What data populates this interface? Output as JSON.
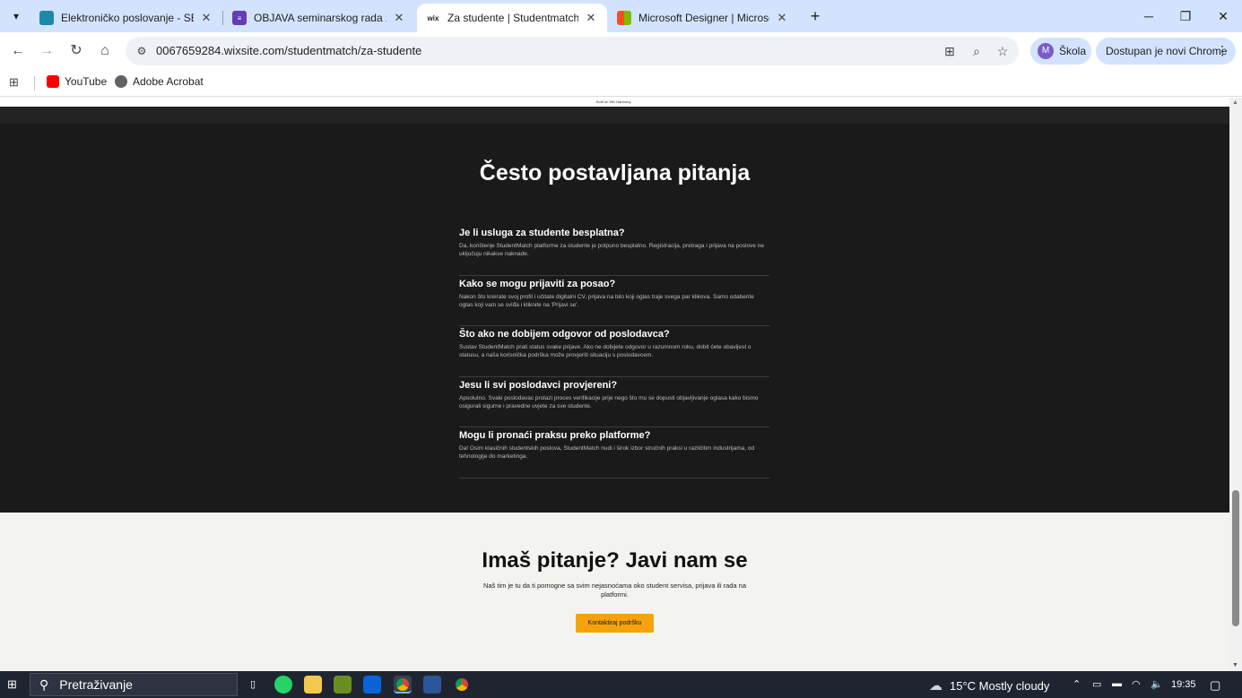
{
  "browser": {
    "tabs": [
      {
        "title": "Elektroničko poslovanje - SEMI",
        "favicon_color": "#1e88a8",
        "active": false
      },
      {
        "title": "OBJAVA seminarskog rada za ko",
        "favicon_color": "#673ab7",
        "active": false
      },
      {
        "title": "Za studente | Studentmatch",
        "favicon_label": "wix",
        "active": true
      },
      {
        "title": "Microsoft Designer | Microsoft",
        "favicon_color": "#f25022",
        "active": false
      }
    ],
    "url": "0067659284.wixsite.com/studentmatch/za-studente",
    "profile": {
      "initial": "M",
      "name": "Škola"
    },
    "update_label": "Dostupan je novi Chrome",
    "bookmarks": [
      {
        "label": "YouTube",
        "icon": "youtube-icon"
      },
      {
        "label": "Adobe Acrobat",
        "icon": "globe-icon"
      }
    ]
  },
  "page": {
    "wix_banner": "Built on Wix Harmony",
    "faq": {
      "heading": "Često postavljana pitanja",
      "items": [
        {
          "q": "Je li usluga za studente besplatna?",
          "a": "Da, korištenje StudentMatch platforme za studente je potpuno besplatno. Registracija, pretraga i prijava na poslove ne uključuju nikakve naknade."
        },
        {
          "q": "Kako se mogu prijaviti za posao?",
          "a": "Nakon što kreirate svoj profil i učitate digitalni CV, prijava na bilo koji oglas traje svega par klikova. Samo odaberite oglas koji vam se sviđa i kliknite na 'Prijavi se'."
        },
        {
          "q": "Što ako ne dobijem odgovor od poslodavca?",
          "a": "Sustav StudentMatch prati status svake prijave. Ako ne dobijete odgovor u razumnom roku, dobit ćete obavijest o statusu, a naša korisnička podrška može provjeriti situaciju s poslodavcem."
        },
        {
          "q": "Jesu li svi poslodavci provjereni?",
          "a": "Apsolutno. Svaki poslodavac prolazi proces verifikacije prije nego što mu se dopusti objavljivanje oglasa kako bismo osigurali sigurne i pravedne uvjete za sve studente."
        },
        {
          "q": "Mogu li pronaći praksu preko platforme?",
          "a": "Da! Osim klasičnih studentskih poslova, StudentMatch nudi i širok izbor stručnih praksi u različitim industrijama, od tehnologije do marketinga."
        }
      ]
    },
    "contact": {
      "heading": "Imaš pitanje? Javi nam se",
      "text": "Naš tim je tu da ti pomogne sa svim nejasnoćama oko student servisa, prijava ili rada na platformi.",
      "button": "Kontaktiraj podršku"
    }
  },
  "taskbar": {
    "search_placeholder": "Pretraživanje",
    "weather": "15°C  Mostly cloudy",
    "time": "19:35"
  }
}
